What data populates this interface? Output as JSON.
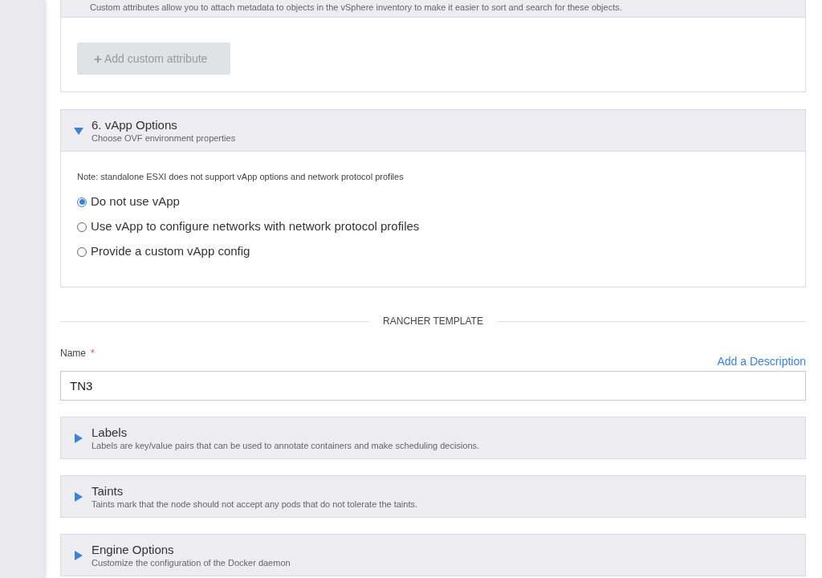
{
  "custom_attributes": {
    "description": "Custom attributes allow you to attach metadata to objects in the vSphere inventory to make it easier to sort and search for these objects.",
    "button": {
      "icon": "+",
      "label": "Add custom attribute",
      "disabled": true
    }
  },
  "vapp": {
    "title": "6. vApp Options",
    "description": "Choose OVF environment properties",
    "expanded": true,
    "note": "Note: standalone ESXI does not support vApp options and network protocol profiles",
    "options": [
      {
        "label": "Do not use vApp",
        "selected": true
      },
      {
        "label": "Use vApp to configure networks with network protocol profiles",
        "selected": false
      },
      {
        "label": "Provide a custom vApp config",
        "selected": false
      }
    ]
  },
  "divider": "RANCHER TEMPLATE",
  "name_field": {
    "label": "Name",
    "required": "*",
    "value": "TN3",
    "link": "Add a Description"
  },
  "sections": [
    {
      "title": "Labels",
      "description": "Labels are key/value pairs that can be used to annotate containers and make scheduling decisions.",
      "expanded": false
    },
    {
      "title": "Taints",
      "description": "Taints mark that the node should not accept any pods that do not tolerate the taints.",
      "expanded": false
    },
    {
      "title": "Engine Options",
      "description": "Customize the configuration of the Docker daemon",
      "expanded": false
    }
  ]
}
